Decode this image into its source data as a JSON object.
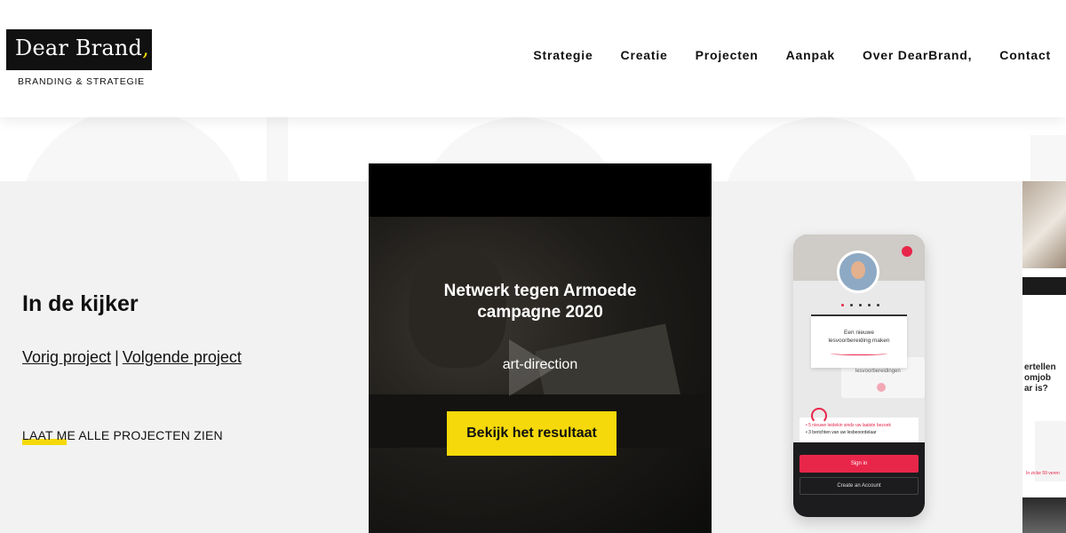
{
  "brand": {
    "name": "Dear Brand",
    "comma": ",",
    "tagline": "BRANDING & STRATEGIE",
    "accent_color": "#f5d90a"
  },
  "nav": {
    "items": [
      {
        "label": "Strategie"
      },
      {
        "label": "Creatie"
      },
      {
        "label": "Projecten"
      },
      {
        "label": "Aanpak"
      },
      {
        "label": "Over DearBrand,"
      },
      {
        "label": "Contact"
      }
    ]
  },
  "kijker": {
    "title": "In de kijker",
    "prev_label": "Vorig project",
    "separator": "|",
    "next_label": "Volgende project",
    "all_label": "LAAT ME ALLE PROJECTEN ZIEN"
  },
  "video": {
    "title_line1": "Netwerk tegen Armoede",
    "title_line2": "campagne 2020",
    "subtitle": "art-direction",
    "cta_label": "Bekijk het resultaat",
    "icon": "play-icon"
  },
  "phone": {
    "card_front_line1": "Een nieuwe",
    "card_front_line2": "lesvoorbereiding maken",
    "card_back_line1": "lesvoorbereidingen",
    "notif_line1": "• 5 nieuwe leidekin sinds uw laatste bezoek",
    "notif_line2": "• 3 berichten van uw lesbeoordelaar",
    "signin_label": "Sign in",
    "create_label": "Create an Account",
    "accent_color": "#e8264a"
  },
  "peek": {
    "question_line1": "ertellen",
    "question_line2": "omjob",
    "question_line3": "ar is?",
    "small_text": "In zicke 59 veren"
  }
}
